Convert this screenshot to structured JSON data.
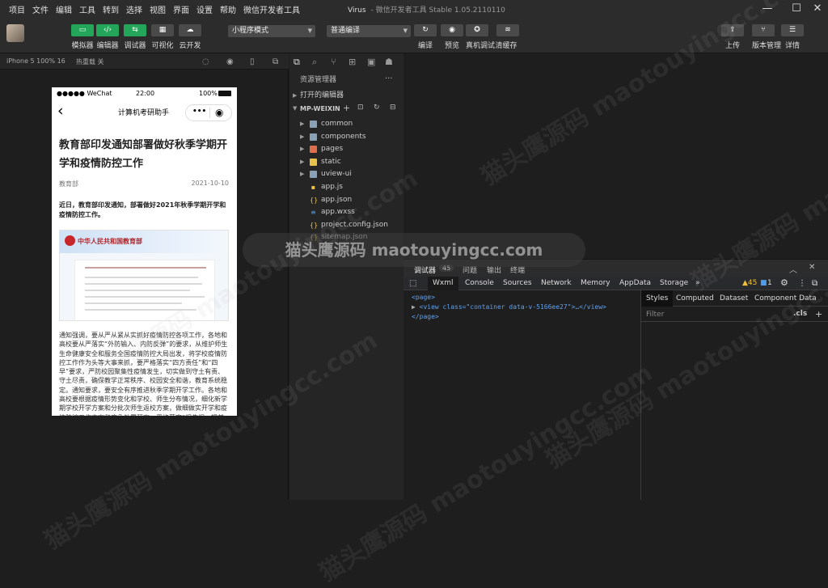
{
  "menu": [
    "项目",
    "文件",
    "编辑",
    "工具",
    "转到",
    "选择",
    "视图",
    "界面",
    "设置",
    "帮助",
    "微信开发者工具"
  ],
  "window": {
    "title_app": "Virus",
    "title_rest": "- 微信开发者工具 Stable 1.05.2110110"
  },
  "toolbar": {
    "left_buttons": [
      {
        "label": "模拟器",
        "glyph": "▭"
      },
      {
        "label": "编辑器",
        "glyph": "‹/›"
      },
      {
        "label": "调试器",
        "glyph": "⇆"
      },
      {
        "label": "可视化",
        "glyph": "▦"
      },
      {
        "label": "云开发",
        "glyph": "☁"
      }
    ],
    "mode_select": "小程序模式",
    "compile_select": "普通编译",
    "mid_buttons": [
      "编译",
      "预览",
      "真机调试",
      "清缓存"
    ],
    "right_buttons": [
      "上传",
      "版本管理",
      "详情"
    ]
  },
  "simulator_bar": {
    "device": "iPhone 5 100% 16",
    "hot_reload": "热重载 关"
  },
  "phone": {
    "signal": "●●●●● WeChat",
    "time": "22:00",
    "battery": "100%",
    "nav_title": "计算机考研助手",
    "article": {
      "title": "教育部印发通知部署做好秋季学期开学和疫情防控工作",
      "source": "教育部",
      "date": "2021-10-10",
      "lead": "近日，教育部印发通知，部署做好2021年秋季学期开学和疫情防控工作。",
      "image_header": "中华人民共和国教育部",
      "body": "通知强调，要从严从紧从实抓好疫情防控各项工作，各地和高校要从严落实“外防输入、内防反弹”的要求，从维护师生生命健康安全和服务全国疫情防控大局出发，将学校疫情防控工作作为头等大事来抓，要严格落实“四方责任”和“四早”要求，严防校园聚集性疫情发生，切实做到守土有责、守土尽责，确保教学正常秩序、校园安全和谐，教育系统稳定。通知要求，要安全有序推进秋季学期开学工作。各地和高校要根据疫情形势变化和学校、师生分布情况，细化新学期学校开学方案和分批次师生返校方案，做细做实开学和疫情防控工作方案和应急处置预案，严格落实“报告报、提前"
    }
  },
  "explorer": {
    "title": "资源管理器",
    "open_editors": "打开的编辑器",
    "project": "MP-WEIXIN",
    "items": [
      {
        "name": "common",
        "type": "folder",
        "color": "#8aa0b6"
      },
      {
        "name": "components",
        "type": "folder",
        "color": "#8aa0b6"
      },
      {
        "name": "pages",
        "type": "folder",
        "color": "#e06c4e"
      },
      {
        "name": "static",
        "type": "folder",
        "color": "#e8c14b"
      },
      {
        "name": "uview-ui",
        "type": "folder",
        "color": "#8aa0b6"
      },
      {
        "name": "app.js",
        "type": "js",
        "color": "#e8c14b"
      },
      {
        "name": "app.json",
        "type": "json",
        "color": "#e8c14b"
      },
      {
        "name": "app.wxss",
        "type": "wxss",
        "color": "#4f9de8"
      },
      {
        "name": "project.config.json",
        "type": "json",
        "color": "#e8c14b"
      },
      {
        "name": "sitemap.json",
        "type": "json",
        "color": "#e8c14b"
      }
    ]
  },
  "watermark": "猫头鹰源码 maotouyingcc.com",
  "devtools": {
    "top_tabs": [
      "调试器",
      "问题",
      "输出",
      "终端"
    ],
    "debugger_badge": "45",
    "tabs": [
      "Wxml",
      "Console",
      "Sources",
      "Network",
      "Memory",
      "AppData",
      "Storage"
    ],
    "more": "»",
    "warnings": "▲45",
    "info": "1",
    "dom": [
      "<page>",
      "<view class=\"container data-v-5166ee27\">…</view>",
      "</page>"
    ],
    "styles_tabs": [
      "Styles",
      "Computed",
      "Dataset",
      "Component Data"
    ],
    "filter_placeholder": "Filter",
    "cls": ".cls",
    "plus": "+"
  }
}
